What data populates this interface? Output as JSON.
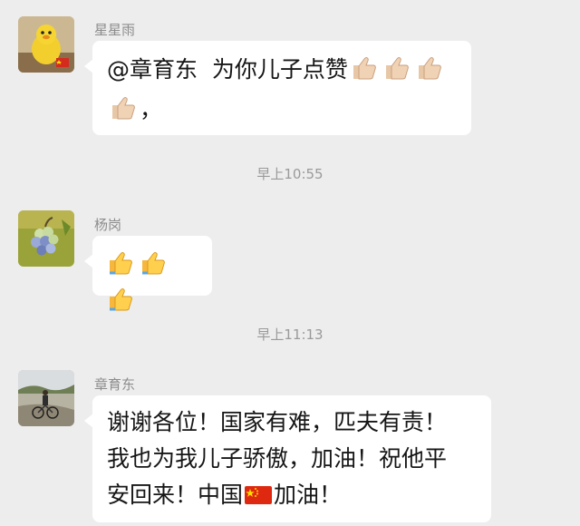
{
  "messages": [
    {
      "sender": "星星雨",
      "mention": "@章育东",
      "text": "为你儿子点赞",
      "trailing_text": "，",
      "emoji": [
        "thumbs-up-light",
        "thumbs-up-light",
        "thumbs-up-light",
        "thumbs-up-light"
      ]
    },
    {
      "sender": "杨岗",
      "emoji": [
        "thumbs-up-yellow",
        "thumbs-up-yellow",
        "thumbs-up-yellow"
      ]
    },
    {
      "sender": "章育东",
      "line1": "谢谢各位！国家有难，匹夫有责！",
      "line2": "我也为我儿子骄傲，加油！祝他平",
      "line3_before": "安回来！中国",
      "line3_after": "加油！",
      "emoji": [
        "china-flag"
      ]
    }
  ],
  "timestamps": [
    "早上10:55",
    "早上11:13"
  ],
  "colors": {
    "background": "#ededed",
    "bubble": "#ffffff",
    "text": "#161616",
    "meta_text": "#8c8c8c"
  }
}
